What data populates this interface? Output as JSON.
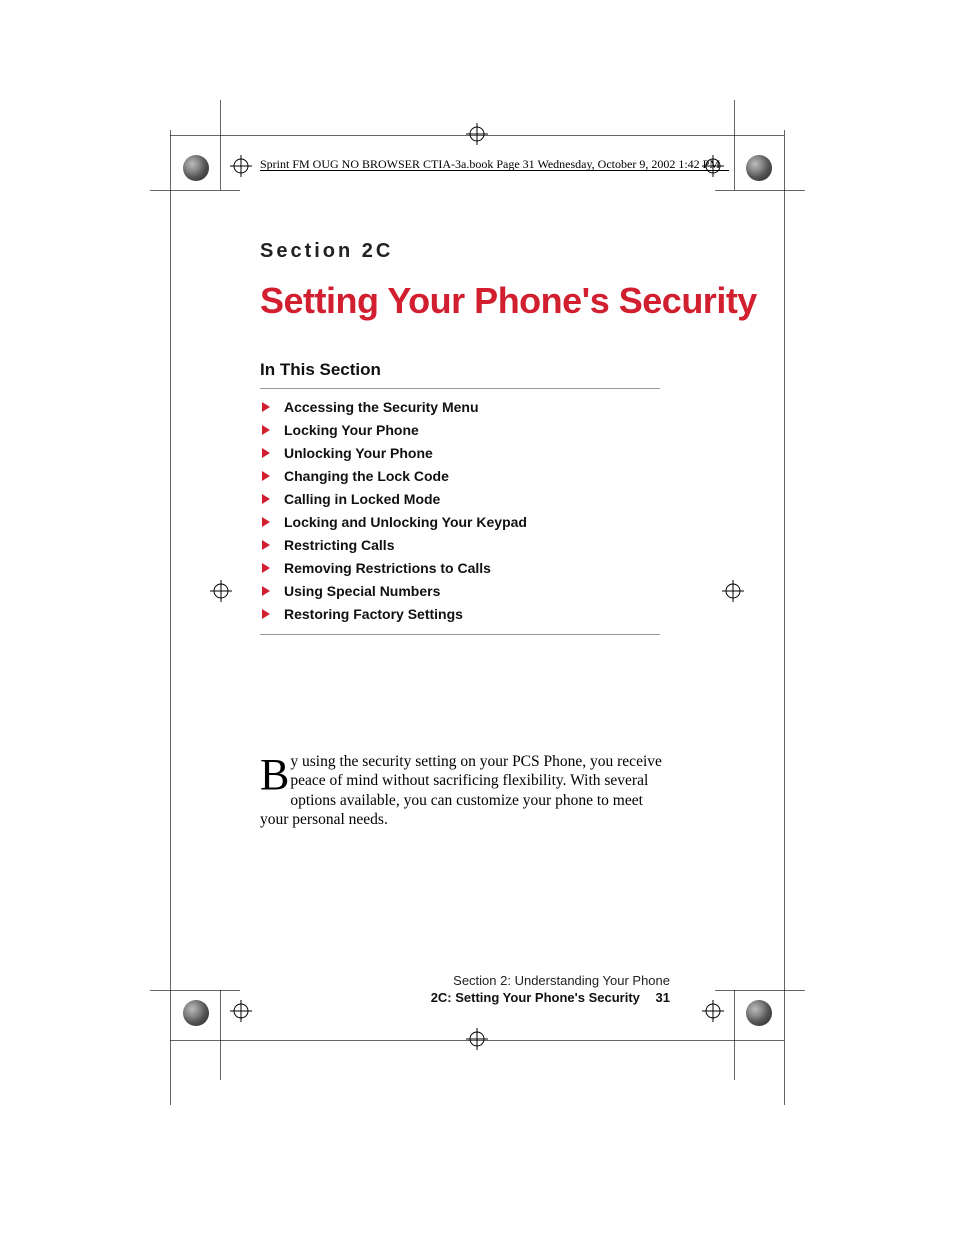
{
  "header_text": "Sprint FM OUG NO BROWSER CTIA-3a.book  Page 31  Wednesday, October 9, 2002  1:42 PM",
  "section_label": "Section 2C",
  "page_title": "Setting Your Phone's Security",
  "in_this_section_label": "In This Section",
  "toc": [
    "Accessing the Security Menu",
    "Locking Your Phone",
    "Unlocking Your Phone",
    "Changing the Lock Code",
    "Calling in Locked Mode",
    "Locking and Unlocking Your Keypad",
    "Restricting Calls",
    "Removing Restrictions to Calls",
    "Using Special Numbers",
    "Restoring Factory Settings"
  ],
  "body_dropcap": "B",
  "body_rest": "y using the security setting on your PCS Phone, you receive peace of mind without sacrificing flexibility. With several options available, you can customize your phone to meet your personal needs.",
  "footer_line1": "Section 2: Understanding Your Phone",
  "footer_line2": "2C: Setting Your Phone's Security",
  "footer_page": "31"
}
